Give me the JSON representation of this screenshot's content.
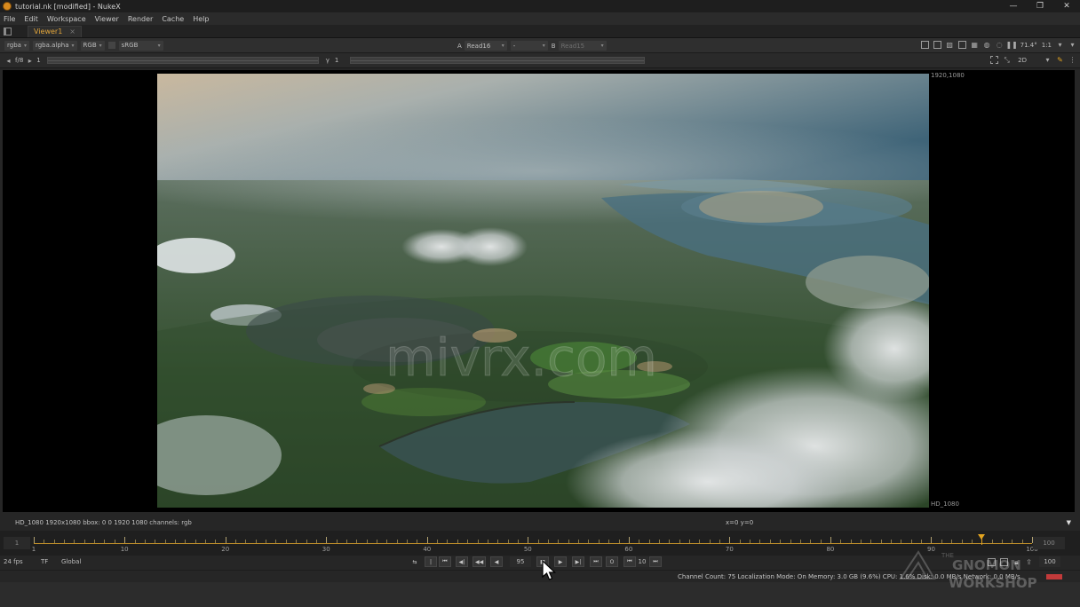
{
  "window": {
    "title": "tutorial.nk [modified] - NukeX",
    "controls": [
      "—",
      "❐",
      "✕"
    ]
  },
  "menu": [
    "File",
    "Edit",
    "Workspace",
    "Viewer",
    "Render",
    "Cache",
    "Help"
  ],
  "tab": {
    "label": "Viewer1",
    "close": "×"
  },
  "viewer_toolbar": {
    "channels": "rgba",
    "alpha": "rgba.alpha",
    "display": "RGB",
    "lut": "sRGB",
    "input_a_label": "A",
    "input_a": "Read16",
    "input_a_op": "-",
    "input_b_label": "B",
    "input_b": "Read15",
    "zoom": "71.4°",
    "ratio": "1:1",
    "view_mode": "2D"
  },
  "viewer_toolbar2": {
    "fstop": "f/8",
    "gain_value": "1",
    "gamma_label": "γ",
    "gamma_value": "1"
  },
  "viewer": {
    "top_right_label": "1920,1080",
    "bottom_right_label": "HD_1080",
    "watermark": "mivrx.com"
  },
  "infobar": {
    "left": "HD_1080 1920x1080  bbox: 0 0 1920 1080 channels: rgb",
    "coords": "x=0 y=0",
    "arrow": "▼"
  },
  "timeline": {
    "start": "1",
    "end": "100",
    "current_frame": 95,
    "range": [
      1,
      100
    ],
    "tick_labels": [
      "1",
      "10",
      "20",
      "30",
      "40",
      "50",
      "60",
      "70",
      "80",
      "90",
      "100"
    ],
    "tick_values": [
      1,
      10,
      20,
      30,
      40,
      50,
      60,
      70,
      80,
      90,
      100
    ]
  },
  "playback": {
    "fps": "24 fps",
    "tf": "TF",
    "scope": "Global",
    "current_frame_field": "95",
    "increment": "10",
    "end_frame_field": "100",
    "buttons": [
      "|",
      "⏮",
      "◀|",
      "◀◀",
      "◀",
      "■",
      "▶",
      "▶|",
      "⏭",
      "O",
      "⏮",
      "⏭"
    ]
  },
  "status": {
    "text": "Channel Count: 75  Localization Mode: On  Memory: 3.0 GB (9.6%)  CPU: 1.6%  Disk: 0.0 MB/s  Network: 0.0 MB/s"
  },
  "brand": {
    "line1": "THE",
    "line2": "GNOMON",
    "line3": "WORKSHOP"
  },
  "colors": {
    "accent": "#e3a420",
    "tab_label": "#e2a53a",
    "status_meter": "#c23a3a"
  }
}
